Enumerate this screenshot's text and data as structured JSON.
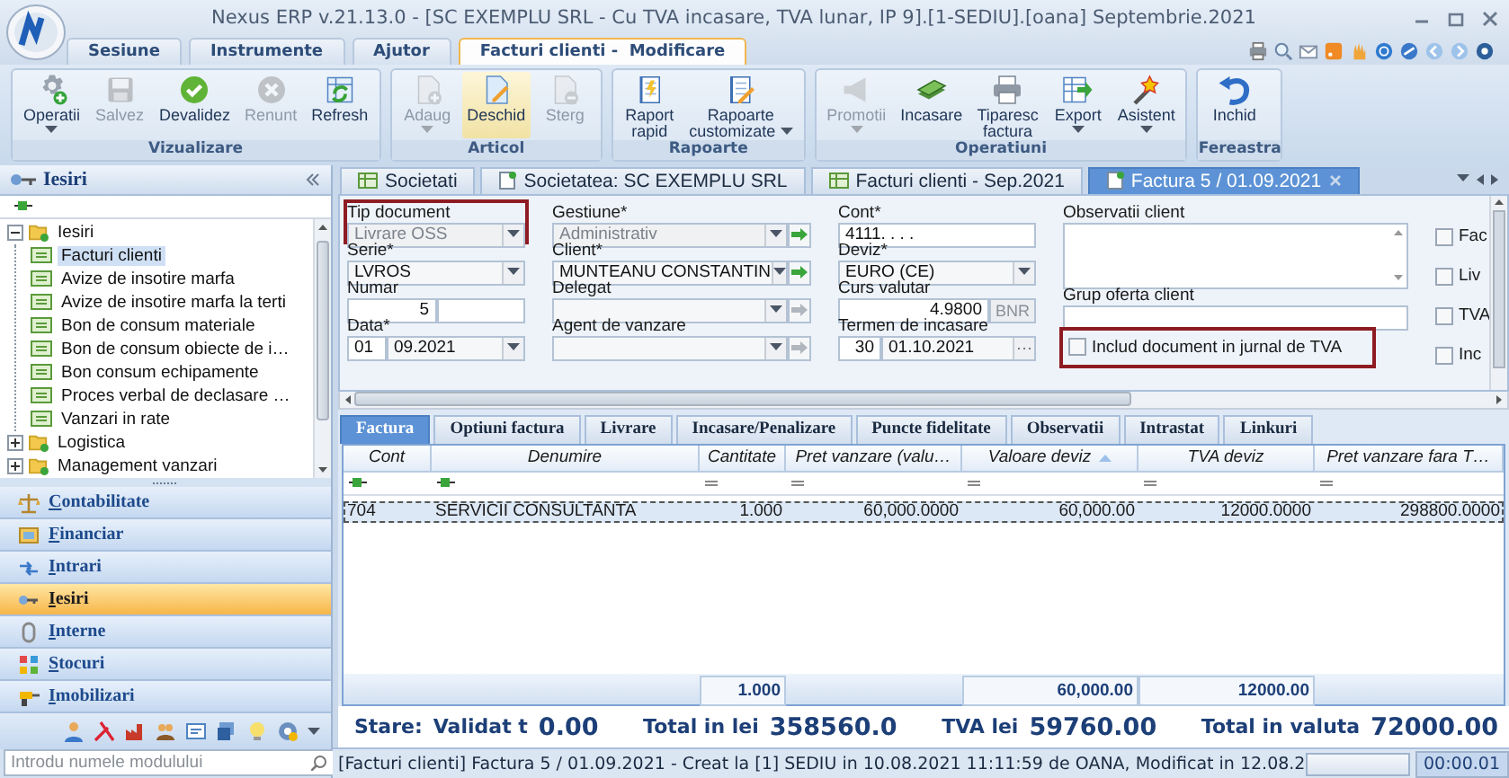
{
  "window": {
    "title": "Nexus ERP v.21.13.0 - [SC EXEMPLU SRL - Cu TVA incasare, TVA lunar, IP 9].[1-SEDIU].[oana] Septembrie.2021"
  },
  "menu_tabs": [
    {
      "label": "Sesiune",
      "selected": false
    },
    {
      "label": "Instrumente",
      "selected": false
    },
    {
      "label": "Ajutor",
      "selected": false
    },
    {
      "label": "Facturi clienti -  Modificare",
      "selected": true
    }
  ],
  "ribbon": [
    {
      "group": "Vizualizare",
      "buttons": [
        {
          "label": "Operatii",
          "disabled": false,
          "dropdown": true,
          "pressed": false
        },
        {
          "label": "Salvez",
          "disabled": true,
          "dropdown": false,
          "pressed": false
        },
        {
          "label": "Devalidez",
          "disabled": false,
          "dropdown": false,
          "pressed": false
        },
        {
          "label": "Renunt",
          "disabled": true,
          "dropdown": false,
          "pressed": false
        },
        {
          "label": "Refresh",
          "disabled": false,
          "dropdown": false,
          "pressed": false
        }
      ]
    },
    {
      "group": "Articol",
      "buttons": [
        {
          "label": "Adaug",
          "disabled": true,
          "dropdown": true,
          "pressed": false
        },
        {
          "label": "Deschid",
          "disabled": false,
          "dropdown": false,
          "pressed": true
        },
        {
          "label": "Sterg",
          "disabled": true,
          "dropdown": false,
          "pressed": false
        }
      ]
    },
    {
      "group": "Rapoarte",
      "buttons": [
        {
          "label": "Raport rapid",
          "disabled": false,
          "dropdown": false,
          "pressed": false
        },
        {
          "label": "Rapoarte customizate",
          "disabled": false,
          "dropdown": true,
          "pressed": false
        }
      ]
    },
    {
      "group": "Operatiuni",
      "buttons": [
        {
          "label": "Promotii",
          "disabled": true,
          "dropdown": true,
          "pressed": false
        },
        {
          "label": "Incasare",
          "disabled": false,
          "dropdown": false,
          "pressed": false
        },
        {
          "label": "Tiparesc factura",
          "disabled": false,
          "dropdown": false,
          "pressed": false
        },
        {
          "label": "Export",
          "disabled": false,
          "dropdown": true,
          "pressed": false
        },
        {
          "label": "Asistent",
          "disabled": false,
          "dropdown": true,
          "pressed": false
        }
      ]
    },
    {
      "group": "Fereastra",
      "buttons": [
        {
          "label": "Inchid",
          "disabled": false,
          "dropdown": false,
          "pressed": false
        }
      ]
    }
  ],
  "sidebar": {
    "title": "Iesiri",
    "tree": [
      {
        "label": "Iesiri",
        "expanded": true,
        "selected": false,
        "children": [
          {
            "label": "Facturi clienti",
            "selected": true
          },
          {
            "label": "Avize de insotire marfa",
            "selected": false
          },
          {
            "label": "Avize de insotire marfa la terti",
            "selected": false
          },
          {
            "label": "Bon de consum materiale",
            "selected": false
          },
          {
            "label": "Bon de consum obiecte de i…",
            "selected": false
          },
          {
            "label": "Bon consum echipamente",
            "selected": false
          },
          {
            "label": "Proces verbal de declasare …",
            "selected": false
          },
          {
            "label": "Vanzari in rate",
            "selected": false
          }
        ]
      },
      {
        "label": "Logistica",
        "expanded": false,
        "selected": false
      },
      {
        "label": "Management vanzari",
        "expanded": false,
        "selected": false
      }
    ],
    "modules": [
      {
        "label": "Contabilitate",
        "selected": false
      },
      {
        "label": "Financiar",
        "selected": false
      },
      {
        "label": "Intrari",
        "selected": false
      },
      {
        "label": "Iesiri",
        "selected": true
      },
      {
        "label": "Interne",
        "selected": false
      },
      {
        "label": "Stocuri",
        "selected": false
      },
      {
        "label": "Imobilizari",
        "selected": false
      }
    ],
    "search": {
      "placeholder": "Introdu numele modulului"
    }
  },
  "doc_tabs": [
    {
      "label": "Societati",
      "selected": false,
      "closable": false
    },
    {
      "label": "Societatea: SC EXEMPLU SRL",
      "selected": false,
      "closable": false
    },
    {
      "label": "Facturi clienti - Sep.2021",
      "selected": false,
      "closable": false
    },
    {
      "label": "Factura 5 / 01.09.2021",
      "selected": true,
      "closable": true
    }
  ],
  "form": {
    "columns": [
      [
        {
          "kind": "combo",
          "label": "Tip document",
          "value": "Livrare OSS",
          "disabled": true,
          "highlighted": true
        },
        {
          "kind": "combo",
          "label": "Serie*",
          "value": "LVROS",
          "disabled": false,
          "highlighted": false
        },
        {
          "kind": "number",
          "label": "Numar",
          "value": "5",
          "highlighted": false
        },
        {
          "kind": "date",
          "label": "Data*",
          "day": "01",
          "value": "09.2021",
          "highlighted": false
        }
      ],
      [
        {
          "kind": "combo",
          "label": "Gestiune*",
          "value": "Administrativ",
          "disabled": true,
          "highlighted": false,
          "go_button": {
            "disabled": false
          }
        },
        {
          "kind": "combo",
          "label": "Client*",
          "value": "MUNTEANU CONSTANTIN",
          "disabled": false,
          "highlighted": false,
          "go_button": {
            "disabled": false
          }
        },
        {
          "kind": "combo",
          "label": "Delegat",
          "disabled": false,
          "highlighted": false,
          "go_button": {
            "disabled": true
          }
        },
        {
          "kind": "combo",
          "label": "Agent de vanzare",
          "disabled": false,
          "highlighted": false,
          "go_button": {
            "disabled": true
          }
        }
      ],
      [
        {
          "kind": "text",
          "label": "Cont*",
          "value": "4111. . . .",
          "highlighted": false
        },
        {
          "kind": "combo",
          "label": "Deviz*",
          "value": "EURO (CE)",
          "disabled": false,
          "highlighted": false
        },
        {
          "kind": "rate",
          "label": "Curs valutar",
          "value": "4.9800",
          "button": {
            "label": "BNR",
            "disabled": true
          },
          "highlighted": false
        },
        {
          "kind": "term",
          "label": "Termen de incasare",
          "days": "30",
          "value": "01.10.2021",
          "highlighted": false
        }
      ],
      [
        {
          "kind": "memo",
          "label": "Observatii client",
          "highlighted": false
        },
        {
          "kind": "text",
          "label": "Grup oferta client",
          "highlighted": false
        },
        {
          "kind": "checkbox",
          "label": "Includ document in jurnal de TVA",
          "checked": false,
          "highlighted": true
        }
      ],
      [
        {
          "kind": "checkbox",
          "label": "Fac",
          "checked": false,
          "highlighted": false
        },
        {
          "kind": "checkbox",
          "label": "Liv",
          "checked": false,
          "highlighted": false
        },
        {
          "kind": "checkbox",
          "label": "TVA",
          "checked": false,
          "highlighted": false
        },
        {
          "kind": "checkbox",
          "label": "Inc",
          "checked": false,
          "highlighted": false
        }
      ]
    ]
  },
  "sub_tabs": [
    {
      "label": "Factura",
      "selected": true
    },
    {
      "label": "Optiuni factura",
      "selected": false
    },
    {
      "label": "Livrare",
      "selected": false
    },
    {
      "label": "Incasare/Penalizare",
      "selected": false
    },
    {
      "label": "Puncte fidelitate",
      "selected": false
    },
    {
      "label": "Observatii",
      "selected": false
    },
    {
      "label": "Intrastat",
      "selected": false
    },
    {
      "label": "Linkuri",
      "selected": false
    }
  ],
  "table": {
    "columns": [
      {
        "label": "Cont",
        "sorted": false
      },
      {
        "label": "Denumire",
        "sorted": false
      },
      {
        "label": "Cantitate",
        "sorted": false,
        "total": "1.000"
      },
      {
        "label": "Pret vanzare (valu…",
        "sorted": false
      },
      {
        "label": "Valoare deviz",
        "sorted": true,
        "total": "60,000.00"
      },
      {
        "label": "TVA deviz",
        "sorted": false,
        "total": "12000.00"
      },
      {
        "label": "Pret vanzare fara T…",
        "sorted": false
      }
    ],
    "rows": [
      {
        "selected": true,
        "cells": [
          "704",
          "SERVICII CONSULTANTA",
          "1.000",
          "60,000.0000",
          "60,000.00",
          "12000.0000",
          "298800.0000"
        ]
      }
    ]
  },
  "summary": {
    "state_label": "Stare:",
    "state_value": "Validat t",
    "totals": [
      {
        "value": "0.00"
      },
      {
        "label": "Total in lei",
        "value": "358560.0"
      },
      {
        "label": "TVA lei",
        "value": "59760.00"
      },
      {
        "label": "Total in valuta",
        "value": "72000.00"
      }
    ]
  },
  "status_bar": {
    "text": "[Facturi clienti] Factura 5 / 01.09.2021 - Creat la [1] SEDIU  in 10.08.2021 11:11:59 de OANA,  Modificat in 12.08.2",
    "timer": "00:00.01"
  }
}
